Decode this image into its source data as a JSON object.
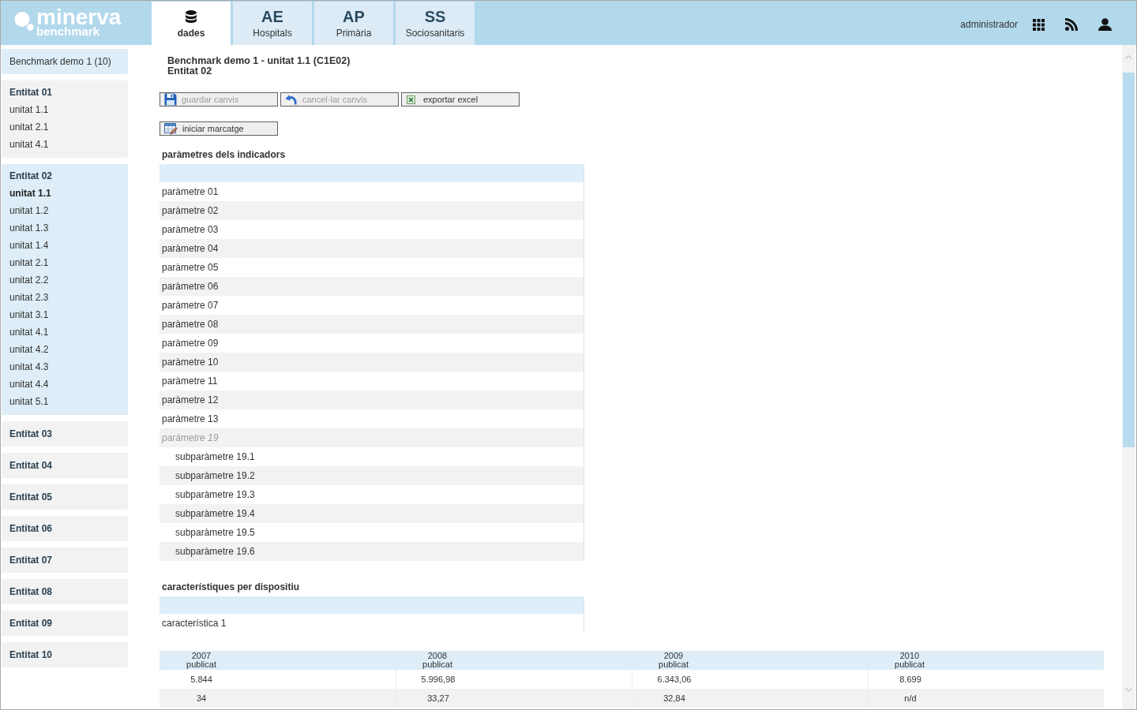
{
  "header": {
    "logo": {
      "name": "minerva",
      "tagline": "benchmark"
    },
    "tabs": [
      {
        "kind": "icon",
        "label": "dades",
        "selected": true
      },
      {
        "kind": "code",
        "code": "AE",
        "label": "Hospitals",
        "selected": false
      },
      {
        "kind": "code",
        "code": "AP",
        "label": "Primària",
        "selected": false
      },
      {
        "kind": "code",
        "code": "SS",
        "label": "Sociosanitaris",
        "selected": false
      }
    ],
    "user": "administrador"
  },
  "sidebar": {
    "benchmark": "Benchmark demo 1 (10)",
    "entities": [
      {
        "title": "Entitat 01",
        "selected": false,
        "units": [
          {
            "label": "unitat 1.1",
            "selected": false
          },
          {
            "label": "unitat 2.1",
            "selected": false
          },
          {
            "label": "unitat 4.1",
            "selected": false
          }
        ]
      },
      {
        "title": "Entitat 02",
        "selected": true,
        "units": [
          {
            "label": "unitat 1.1",
            "selected": true
          },
          {
            "label": "unitat 1.2",
            "selected": false
          },
          {
            "label": "unitat 1.3",
            "selected": false
          },
          {
            "label": "unitat 1.4",
            "selected": false
          },
          {
            "label": "unitat 2.1",
            "selected": false
          },
          {
            "label": "unitat 2.2",
            "selected": false
          },
          {
            "label": "unitat 2.3",
            "selected": false
          },
          {
            "label": "unitat 3.1",
            "selected": false
          },
          {
            "label": "unitat 4.1",
            "selected": false
          },
          {
            "label": "unitat 4.2",
            "selected": false
          },
          {
            "label": "unitat 4.3",
            "selected": false
          },
          {
            "label": "unitat 4.4",
            "selected": false
          },
          {
            "label": "unitat 5.1",
            "selected": false
          }
        ]
      },
      {
        "title": "Entitat 03",
        "selected": false
      },
      {
        "title": "Entitat 04",
        "selected": false
      },
      {
        "title": "Entitat 05",
        "selected": false
      },
      {
        "title": "Entitat 06",
        "selected": false
      },
      {
        "title": "Entitat 07",
        "selected": false
      },
      {
        "title": "Entitat 08",
        "selected": false
      },
      {
        "title": "Entitat 09",
        "selected": false
      },
      {
        "title": "Entitat 10",
        "selected": false
      }
    ]
  },
  "main": {
    "title": "Benchmark demo 1 - unitat 1.1 (C1E02)",
    "subtitle": "Entitat 02",
    "toolbar_rows": [
      {
        "buttons": [
          {
            "kind": "save",
            "label": "guardar canvis",
            "disabled": true
          },
          {
            "kind": "undo",
            "label": "cancel·lar canvis",
            "disabled": true
          },
          {
            "kind": "excel",
            "label": "exportar excel",
            "disabled": false
          }
        ]
      },
      {
        "buttons": [
          {
            "kind": "markup",
            "label": "iniciar marcatge",
            "disabled": false
          }
        ]
      }
    ],
    "parameters": {
      "title": "paràmetres dels indicadors",
      "rows": [
        {
          "label": "paràmetre 01",
          "disabled": false
        },
        {
          "label": "paràmetre 02",
          "disabled": false
        },
        {
          "label": "paràmetre 03",
          "disabled": false
        },
        {
          "label": "paràmetre 04",
          "disabled": false
        },
        {
          "label": "paràmetre 05",
          "disabled": false
        },
        {
          "label": "paràmetre 06",
          "disabled": false
        },
        {
          "label": "paràmetre 07",
          "disabled": false
        },
        {
          "label": "paràmetre 08",
          "disabled": false
        },
        {
          "label": "paràmetre 09",
          "disabled": false
        },
        {
          "label": "paràmetre 10",
          "disabled": false
        },
        {
          "label": "paràmetre 11",
          "disabled": false
        },
        {
          "label": "paràmetre 12",
          "disabled": false
        },
        {
          "label": "paràmetre 13",
          "disabled": false
        },
        {
          "label": "paràmetre 19",
          "disabled": true,
          "children": [
            {
              "label": "subparàmetre 19.1",
              "disabled": false
            },
            {
              "label": "subparàmetre 19.2",
              "disabled": false
            },
            {
              "label": "subparàmetre 19.3",
              "disabled": false
            },
            {
              "label": "subparàmetre 19.4",
              "disabled": false
            },
            {
              "label": "subparàmetre 19.5",
              "disabled": false
            },
            {
              "label": "subparàmetre 19.6",
              "disabled": false
            }
          ]
        }
      ]
    },
    "characteristics": {
      "title": "característiques per dispositiu",
      "rows": [
        {
          "label": "característica 1"
        }
      ]
    },
    "results": {
      "columns": [
        {
          "year": "2007",
          "status": "publicat"
        },
        {
          "year": "2008",
          "status": "publicat"
        },
        {
          "year": "2009",
          "status": "publicat"
        },
        {
          "year": "2010",
          "status": "publicat"
        }
      ],
      "rows": [
        [
          "5.844",
          "5.996,98",
          "6.343,06",
          "8.699"
        ],
        [
          "34",
          "33,27",
          "32,84",
          "n/d"
        ]
      ]
    }
  }
}
